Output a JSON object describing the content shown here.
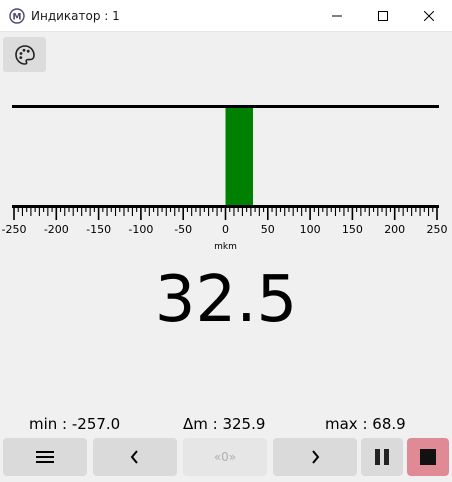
{
  "window": {
    "title": "Индикатор : 1",
    "app_icon_letter": "M"
  },
  "palette_icon": "palette-icon",
  "scale": {
    "unit": "mkm",
    "min": -250,
    "max": 250,
    "major_labels": [
      "-250",
      "-200",
      "-150",
      "-100",
      "-50",
      "0",
      "50",
      "100",
      "150",
      "200",
      "250"
    ],
    "bar_from": 0,
    "bar_to": 32.5,
    "bar_color": "#008000"
  },
  "value": "32.5",
  "stats": {
    "min": "min : -257.0",
    "delta": "Δm : 325.9",
    "max": "max : 68.9"
  },
  "toolbar": {
    "zero_label": "«0»",
    "stop_color": "#e08a96",
    "icons": [
      "menu-icon",
      "chevron-left-icon",
      "chevron-right-icon",
      "pause-icon",
      "stop-icon"
    ]
  }
}
